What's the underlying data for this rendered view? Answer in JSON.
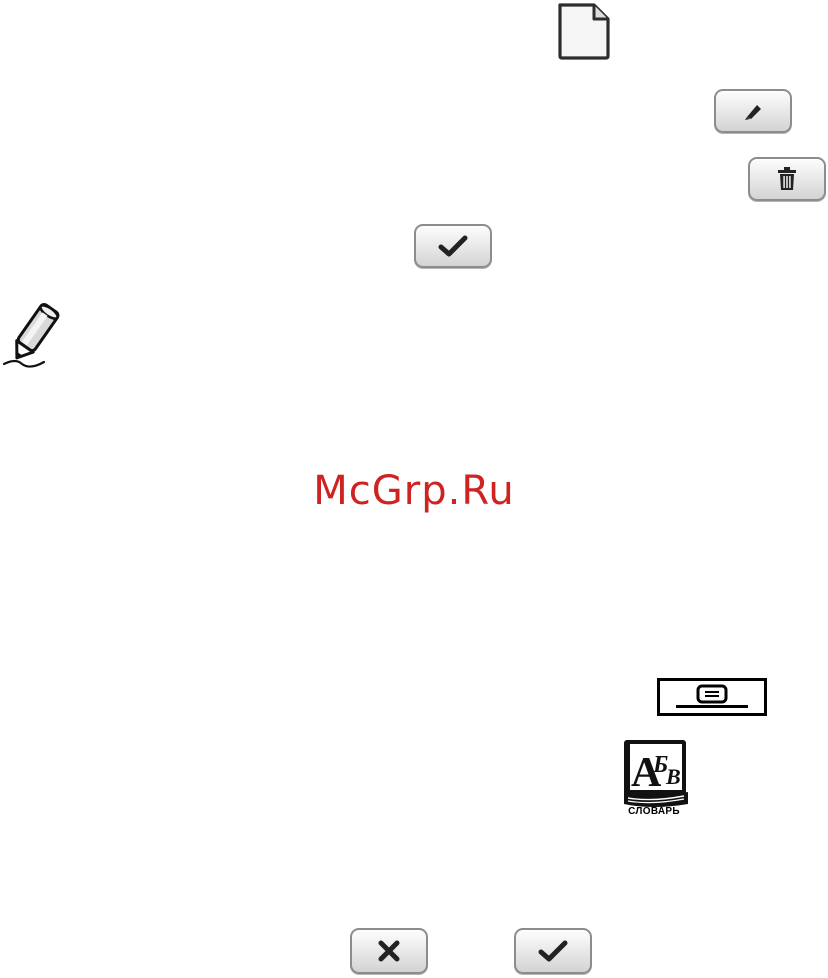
{
  "watermark": "McGrp.Ru",
  "dictionary": {
    "label": "СЛОВАРЬ",
    "letters": "АБВ"
  },
  "icons": {
    "new_document": "document-icon",
    "edit": "pencil-icon",
    "delete": "trash-icon",
    "confirm": "checkmark-icon",
    "note": "note-pencil-icon",
    "menu": "menu-key-icon",
    "dictionary": "dictionary-book-icon",
    "cancel": "close-icon"
  },
  "colors": {
    "watermark": "#cf2222",
    "button_border": "#8c8c8c"
  }
}
